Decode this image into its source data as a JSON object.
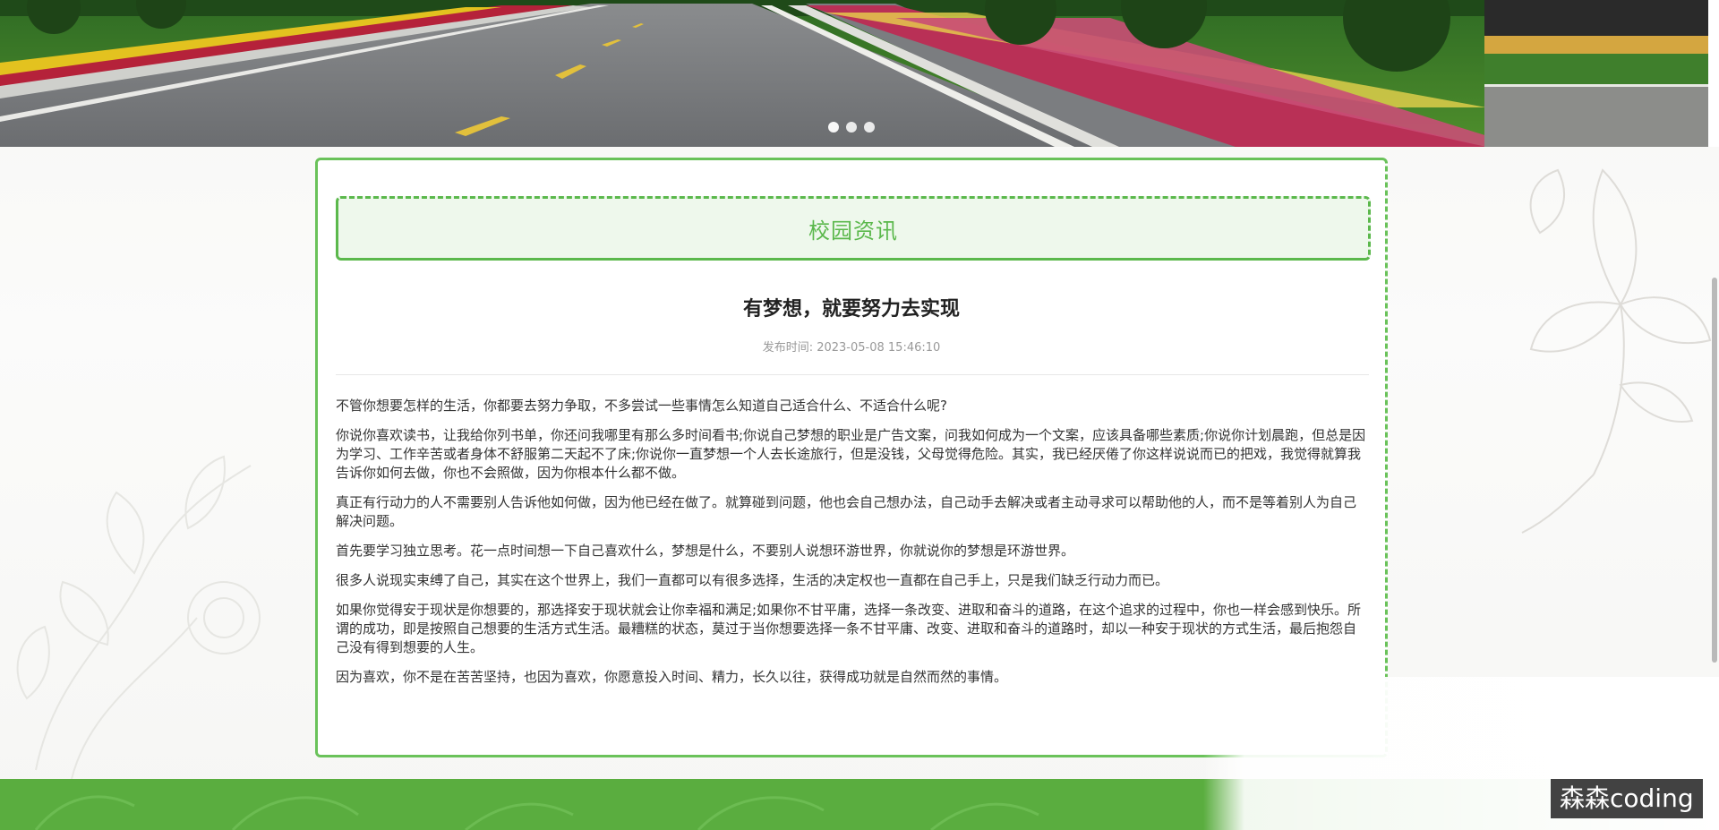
{
  "banner": {
    "carousel_dot_count": 3,
    "active_dot_index": 0
  },
  "section": {
    "title": "校园资讯"
  },
  "article": {
    "title": "有梦想，就要努力去实现",
    "publish_label": "发布时间:",
    "publish_time": "2023-05-08 15:46:10",
    "paragraphs": [
      "不管你想要怎样的生活，你都要去努力争取，不多尝试一些事情怎么知道自己适合什么、不适合什么呢?",
      "你说你喜欢读书，让我给你列书单，你还问我哪里有那么多时间看书;你说自己梦想的职业是广告文案，问我如何成为一个文案，应该具备哪些素质;你说你计划晨跑，但总是因为学习、工作辛苦或者身体不舒服第二天起不了床;你说你一直梦想一个人去长途旅行，但是没钱，父母觉得危险。其实，我已经厌倦了你这样说说而已的把戏，我觉得就算我告诉你如何去做，你也不会照做，因为你根本什么都不做。",
      "真正有行动力的人不需要别人告诉他如何做，因为他已经在做了。就算碰到问题，他也会自己想办法，自己动手去解决或者主动寻求可以帮助他的人，而不是等着别人为自己解决问题。",
      "首先要学习独立思考。花一点时间想一下自己喜欢什么，梦想是什么，不要别人说想环游世界，你就说你的梦想是环游世界。",
      "很多人说现实束缚了自己，其实在这个世界上，我们一直都可以有很多选择，生活的决定权也一直都在自己手上，只是我们缺乏行动力而已。",
      "如果你觉得安于现状是你想要的，那选择安于现状就会让你幸福和满足;如果你不甘平庸，选择一条改变、进取和奋斗的道路，在这个追求的过程中，你也一样会感到快乐。所谓的成功，即是按照自己想要的生活方式生活。最糟糕的状态，莫过于当你想要选择一条不甘平庸、改变、进取和奋斗的道路时，却以一种安于现状的方式生活，最后抱怨自己没有得到想要的人生。",
      "因为喜欢，你不是在苦苦坚持，也因为喜欢，你愿意投入时间、精力，长久以往，获得成功就是自然而然的事情。"
    ]
  },
  "watermark": {
    "text": "森森coding"
  },
  "colors": {
    "accent_green": "#5bb84c",
    "header_bg": "#eef8ec",
    "footer_green": "#5aad3f"
  }
}
